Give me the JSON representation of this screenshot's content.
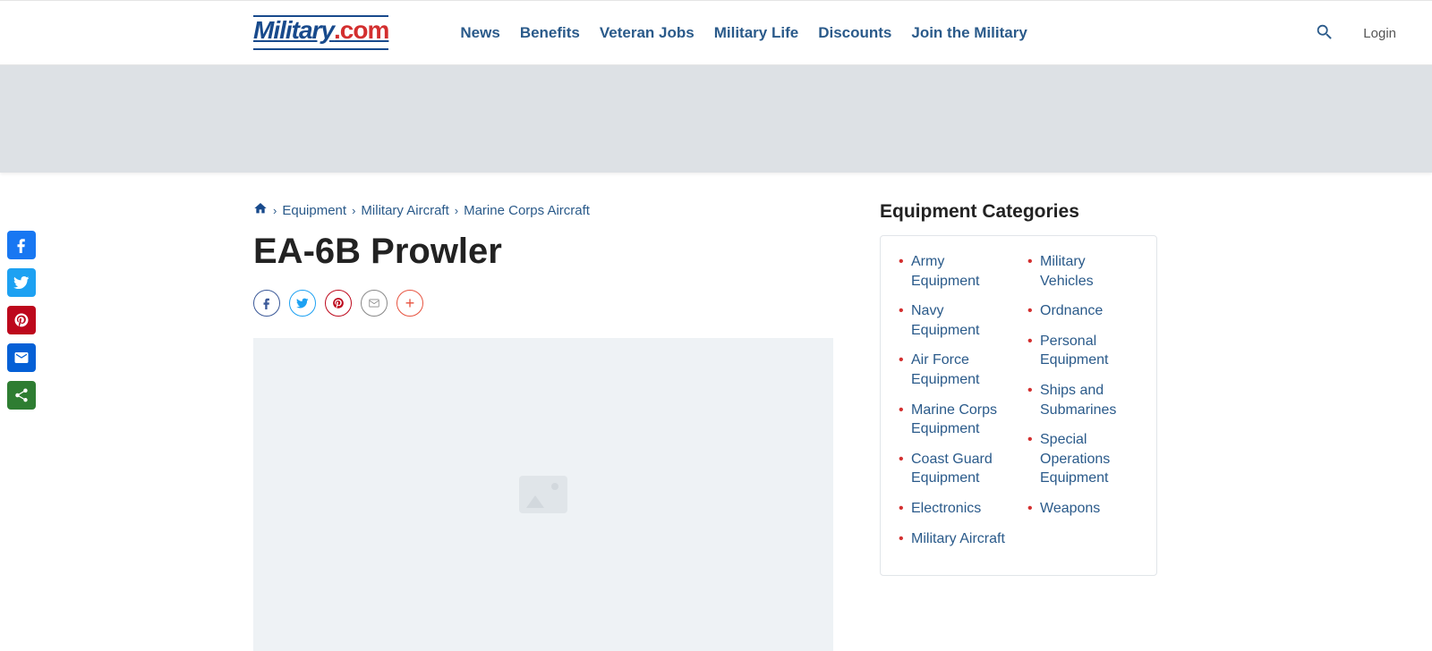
{
  "header": {
    "logo_text": "Military",
    "logo_suffix": ".com",
    "nav": [
      "News",
      "Benefits",
      "Veteran Jobs",
      "Military Life",
      "Discounts",
      "Join the Military"
    ],
    "login_label": "Login"
  },
  "breadcrumb": {
    "items": [
      "Equipment",
      "Military Aircraft",
      "Marine Corps Aircraft"
    ]
  },
  "page": {
    "title": "EA-6B Prowler"
  },
  "sidebar": {
    "title": "Equipment Categories",
    "col1": [
      "Army Equipment",
      "Navy Equipment",
      "Air Force Equipment",
      "Marine Corps Equipment",
      "Coast Guard Equipment",
      "Electronics",
      "Military Aircraft"
    ],
    "col2": [
      "Military Vehicles",
      "Ordnance",
      "Personal Equipment",
      "Ships and Submarines",
      "Special Operations Equipment",
      "Weapons"
    ]
  },
  "share_icons": {
    "facebook": "facebook-icon",
    "twitter": "twitter-icon",
    "pinterest": "pinterest-icon",
    "email": "email-icon",
    "more": "plus-icon",
    "share": "share-icon"
  }
}
